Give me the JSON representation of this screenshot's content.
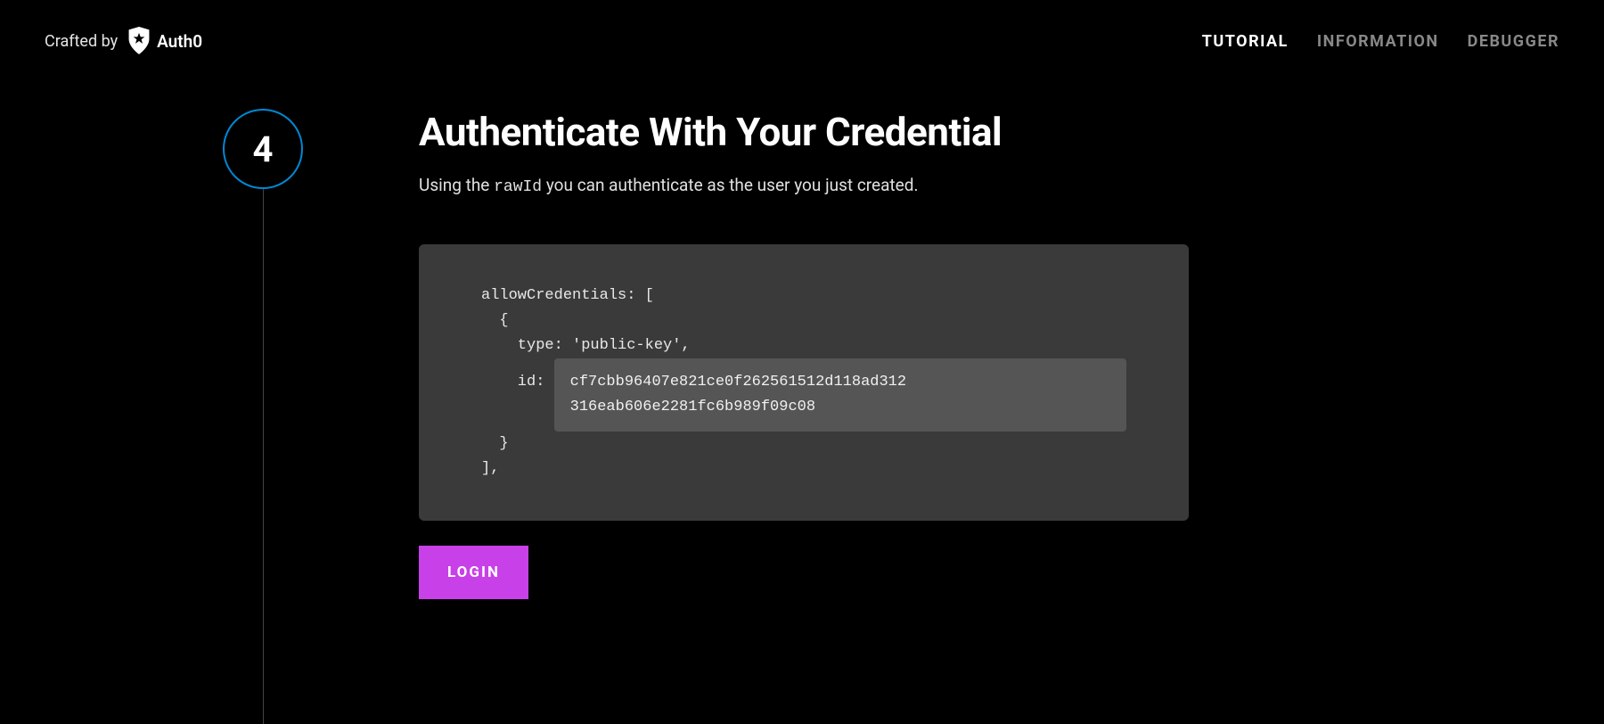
{
  "header": {
    "crafted_by": "Crafted by",
    "brand_name": "Auth0",
    "nav": [
      {
        "label": "TUTORIAL",
        "active": true
      },
      {
        "label": "INFORMATION",
        "active": false
      },
      {
        "label": "DEBUGGER",
        "active": false
      }
    ]
  },
  "step": {
    "number": "4"
  },
  "content": {
    "title": "Authenticate With Your Credential",
    "subtitle_pre": "Using the ",
    "subtitle_code": "rawId",
    "subtitle_post": " you can authenticate as the user you just created."
  },
  "code": {
    "line1": "allowCredentials: [",
    "line2": "  {",
    "line3": "    type: 'public-key',",
    "id_label": "    id: ",
    "id_value_line1": "cf7cbb96407e821ce0f262561512d118ad312",
    "id_value_line2": "316eab606e2281fc6b989f09c08",
    "line5": "  }",
    "line6": "],"
  },
  "actions": {
    "login_label": "LOGIN"
  }
}
